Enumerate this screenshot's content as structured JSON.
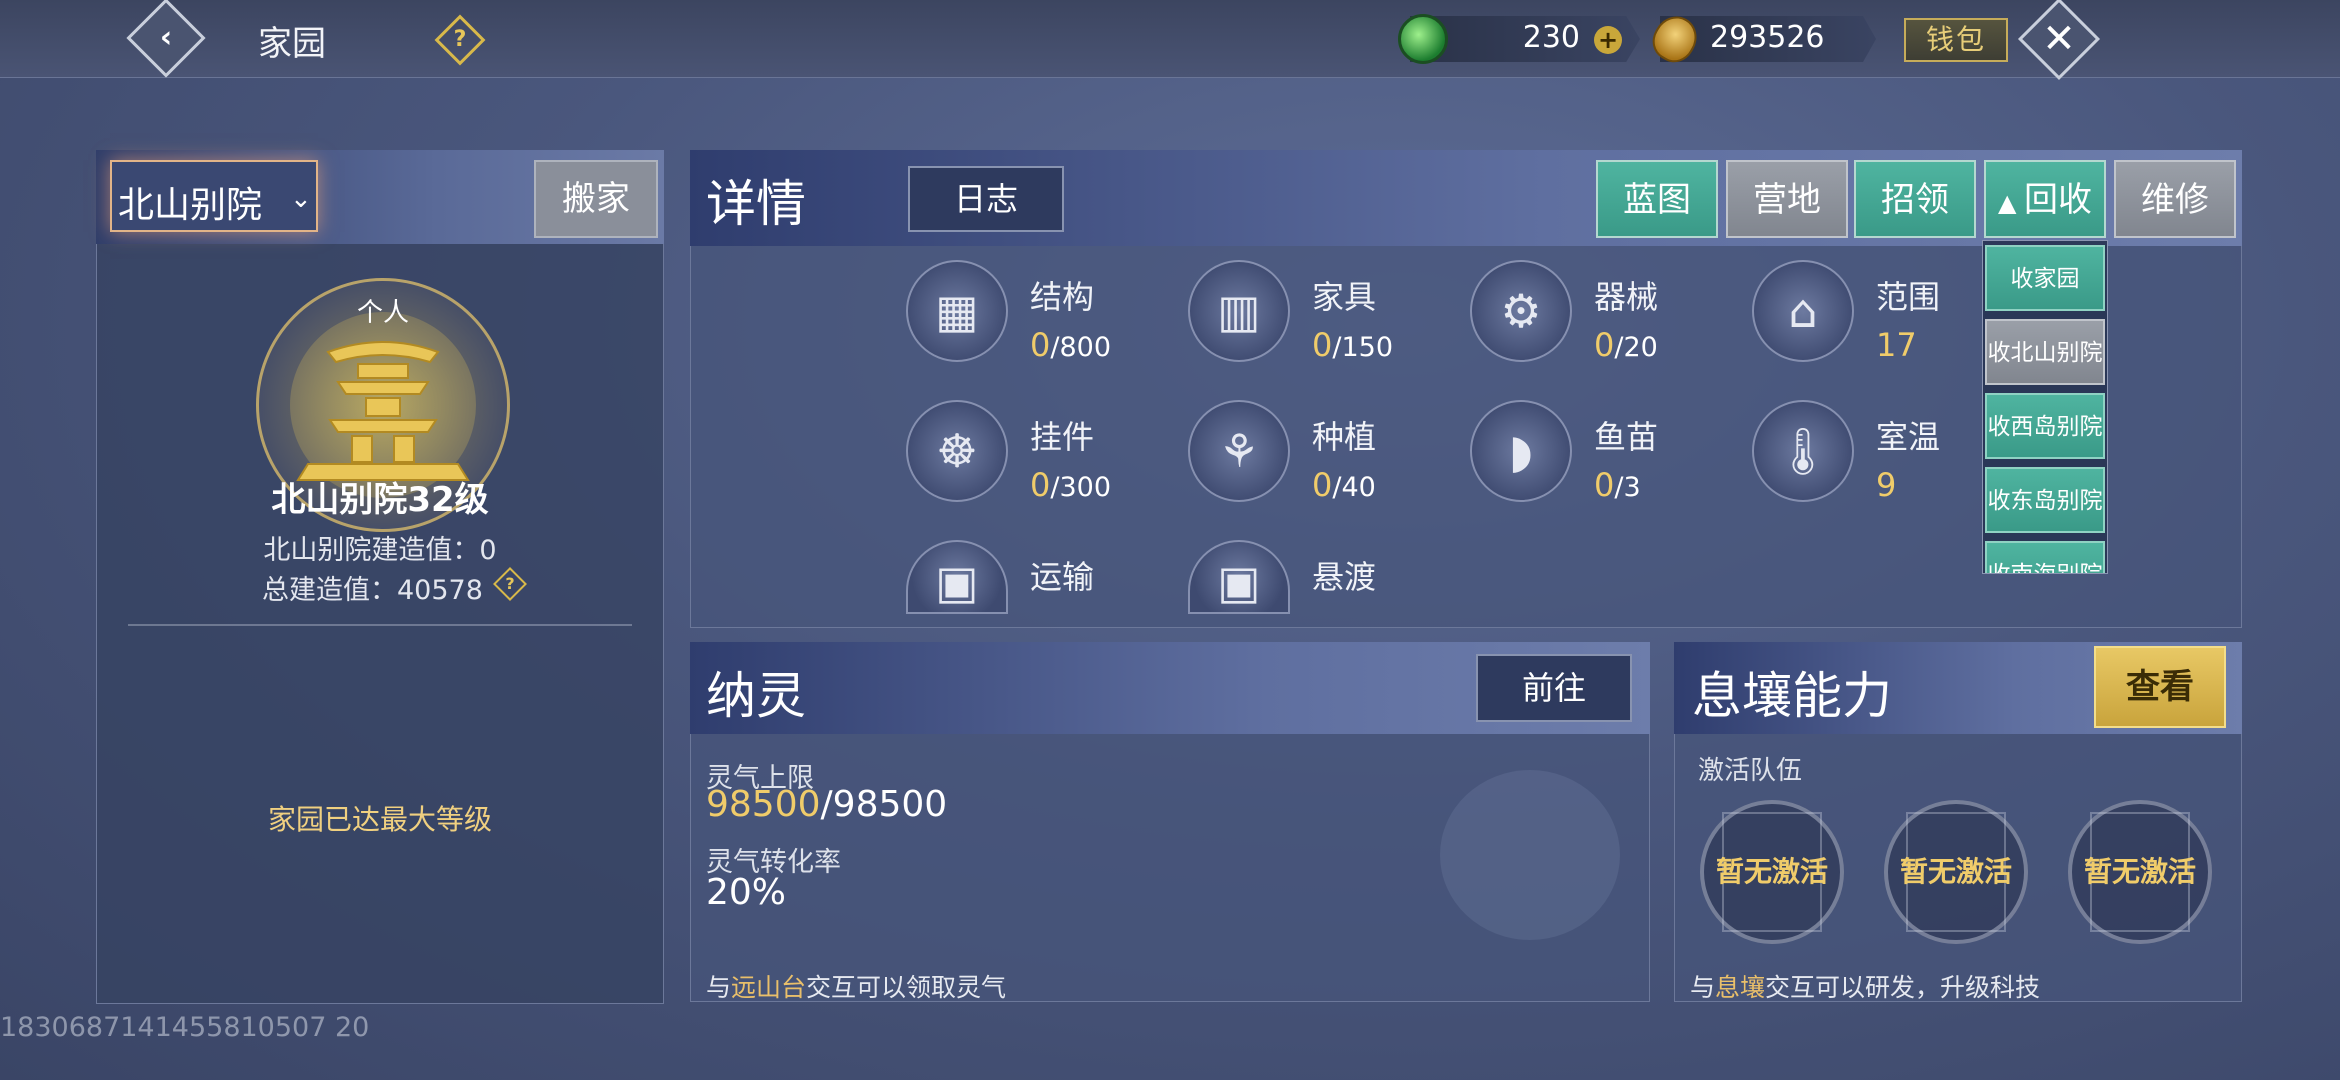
{
  "topbar": {
    "title": "家园",
    "help_glyph": "?",
    "jade": "230",
    "jade_plus": "+",
    "coin": "293526",
    "wallet_label": "钱包"
  },
  "left": {
    "home_name": "北山别院",
    "move_label": "搬家",
    "emblem_tag": "个人",
    "level_text": "北山别院32级",
    "build_value_text": "北山别院建造值：0",
    "total_build_text": "总建造值：40578",
    "max_level_text": "家园已达最大等级",
    "uid": "1830687141455810507 20"
  },
  "detail": {
    "title": "详情",
    "log_label": "日志",
    "buttons": {
      "blueprint": "蓝图",
      "camp": "营地",
      "recruit": "招领",
      "recycle": "回收",
      "repair": "维修"
    },
    "stats": [
      {
        "name": "结构",
        "current": "0",
        "max": "/800",
        "icon": "building-icon"
      },
      {
        "name": "家具",
        "current": "0",
        "max": "/150",
        "icon": "wardrobe-icon"
      },
      {
        "name": "器械",
        "current": "0",
        "max": "/20",
        "icon": "machine-icon"
      },
      {
        "name": "范围",
        "value": "17",
        "icon": "range-icon"
      },
      {
        "name": "挂件",
        "current": "0",
        "max": "/300",
        "icon": "pendant-icon"
      },
      {
        "name": "种植",
        "current": "0",
        "max": "/40",
        "icon": "wheat-icon"
      },
      {
        "name": "鱼苗",
        "current": "0",
        "max": "/3",
        "icon": "fish-icon"
      },
      {
        "name": "室温",
        "value": "9",
        "icon": "thermometer-icon"
      },
      {
        "name": "运输",
        "icon": "train-icon"
      },
      {
        "name": "悬渡",
        "icon": "cable-car-icon"
      }
    ],
    "recycle_menu": [
      "收家园",
      "收北山别院",
      "收西岛别院",
      "收东岛别院",
      "收南海别院"
    ]
  },
  "naling": {
    "title": "纳灵",
    "goto_label": "前往",
    "qi_limit_label": "灵气上限",
    "qi_limit_current": "98500",
    "qi_limit_max": "/98500",
    "qi_rate_label": "灵气转化率",
    "qi_rate_value": "20%",
    "tip_prefix": "与",
    "tip_highlight": "远山台",
    "tip_suffix": "交互可以领取灵气"
  },
  "xirang": {
    "title": "息壤能力",
    "view_label": "查看",
    "team_label": "激活队伍",
    "slots": [
      "暂无激活",
      "暂无激活",
      "暂无激活"
    ],
    "tip_prefix": "与",
    "tip_highlight": "息壤",
    "tip_suffix": "交互可以研发，升级科技"
  },
  "colors": {
    "accent_gold": "#f0cc6a",
    "teal_button": "#4fb4a0",
    "grey_button": "#8a8f9a"
  }
}
